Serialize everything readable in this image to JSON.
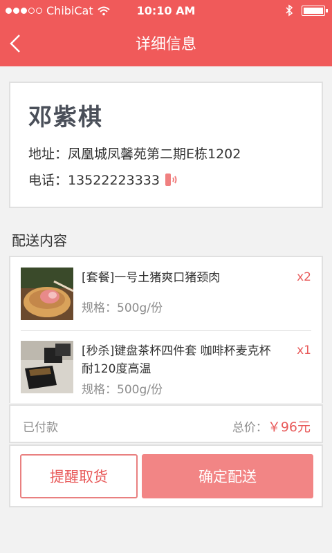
{
  "status_bar": {
    "carrier": "ChibiCat",
    "time": "10:10 AM"
  },
  "navbar": {
    "title": "详细信息"
  },
  "customer": {
    "name": "邓紫棋",
    "address": "地址：凤凰城凤馨苑第二期E栋1202",
    "phone": "电话：13522223333"
  },
  "section": {
    "title": "配送内容"
  },
  "items": [
    {
      "title": "[套餐]一号土猪爽口猪颈肉",
      "spec": "规格：500g/份",
      "qty": "x2",
      "image_icon": "meat-dish-image"
    },
    {
      "title": "[秒杀]键盘茶杯四件套  咖啡杯麦克杯耐120度高温",
      "spec": "规格：500g/份",
      "qty": "x1",
      "image_icon": "cup-set-image"
    }
  ],
  "summary": {
    "status": "已付款",
    "total_label": "总价：",
    "total_value": "￥96元"
  },
  "actions": {
    "remind_label": "提醒取货",
    "confirm_label": "确定配送"
  },
  "colors": {
    "brand": "#f05a5a",
    "accent_text": "#e85a5a",
    "confirm_button": "#f28585"
  }
}
